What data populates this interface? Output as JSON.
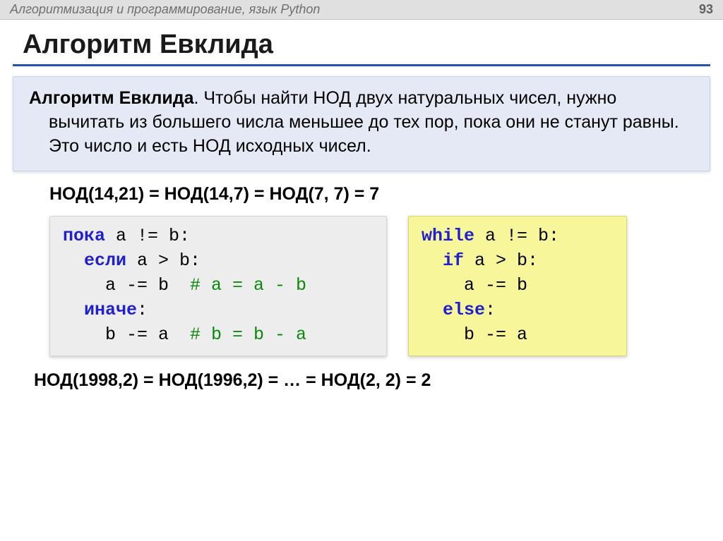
{
  "header": {
    "title": "Алгоритмизация и программирование, язык Python",
    "page_number": "93"
  },
  "slide_title": "Алгоритм Евклида",
  "definition": {
    "term": "Алгоритм Евклида",
    "text": ". Чтобы найти НОД двух натуральных чисел, нужно вычитать из большего числа меньшее до тех пор, пока они не станут равны. Это число и есть НОД исходных чисел."
  },
  "example1": "НОД(14,21) = НОД(14,7) = НОД(7, 7) = 7",
  "pseudo": {
    "l1_a": "пока",
    "l1_b": " a != b:",
    "l2_a": "  если",
    "l2_b": " a > b:",
    "l3_a": "    a -= b  ",
    "l3_c": "# a = a - b",
    "l4_a": "  иначе",
    "l4_b": ":",
    "l5_a": "    b -= a  ",
    "l5_c": "# b = b - a"
  },
  "python": {
    "l1_a": "while",
    "l1_b": " a != b:",
    "l2_a": "  if",
    "l2_b": " a > b:",
    "l3": "    a -= b",
    "l4_a": "  else",
    "l4_b": ":",
    "l5": "    b -= a"
  },
  "example2": "НОД(1998,2) = НОД(1996,2) = … = НОД(2, 2) = 2"
}
